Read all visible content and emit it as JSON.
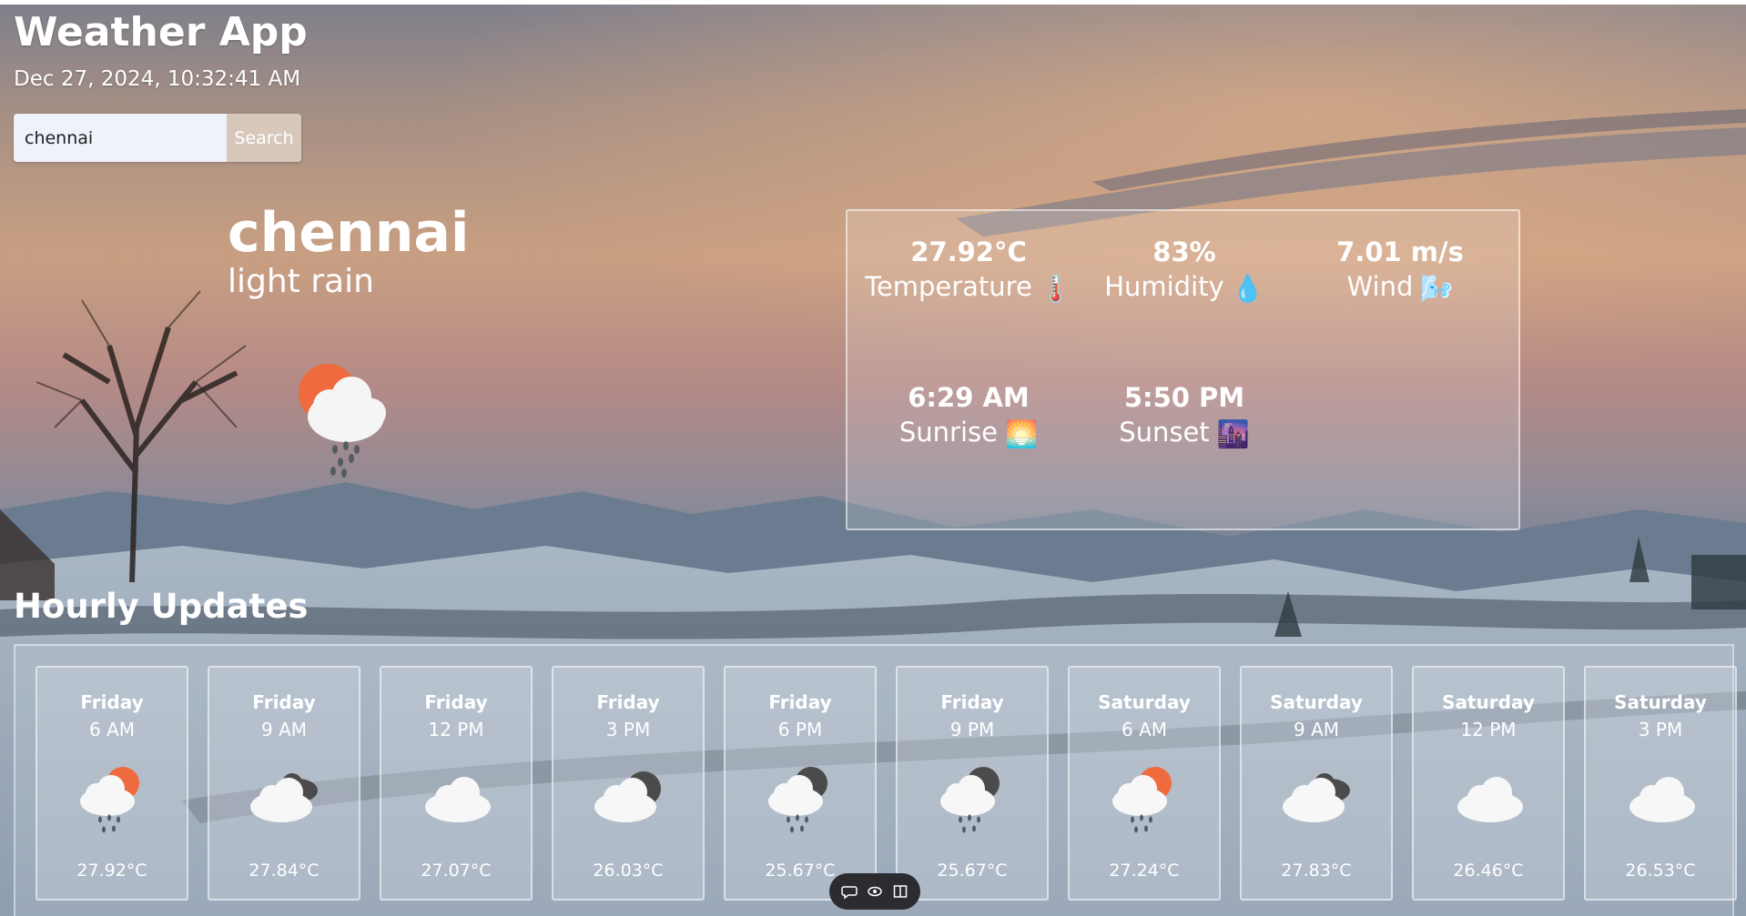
{
  "app": {
    "title": "Weather App",
    "datetime": "Dec 27, 2024, 10:32:41 AM"
  },
  "search": {
    "value": "chennai",
    "button_label": "Search"
  },
  "current": {
    "city": "chennai",
    "condition": "light rain",
    "icon": "sun-cloud-rain-icon"
  },
  "stats": [
    {
      "value": "27.92°C",
      "label": "Temperature",
      "emoji": "🌡️",
      "icon": "thermometer-icon"
    },
    {
      "value": "83%",
      "label": "Humidity",
      "emoji": "💧",
      "icon": "droplet-icon"
    },
    {
      "value": "7.01 m/s",
      "label": "Wind",
      "emoji": "🌬️",
      "icon": "wind-face-icon"
    },
    {
      "value": "6:29 AM",
      "label": "Sunrise",
      "emoji": "🌅",
      "icon": "sunrise-icon"
    },
    {
      "value": "5:50 PM",
      "label": "Sunset",
      "emoji": "🌆",
      "icon": "sunset-icon"
    }
  ],
  "hourly": {
    "title": "Hourly Updates",
    "items": [
      {
        "day": "Friday",
        "time": "6 AM",
        "temp": "27.92°C",
        "icon": "sun-cloud-rain-icon"
      },
      {
        "day": "Friday",
        "time": "9 AM",
        "temp": "27.84°C",
        "icon": "broken-clouds-icon"
      },
      {
        "day": "Friday",
        "time": "12 PM",
        "temp": "27.07°C",
        "icon": "cloud-icon"
      },
      {
        "day": "Friday",
        "time": "3 PM",
        "temp": "26.03°C",
        "icon": "night-cloud-icon"
      },
      {
        "day": "Friday",
        "time": "6 PM",
        "temp": "25.67°C",
        "icon": "night-cloud-rain-icon"
      },
      {
        "day": "Friday",
        "time": "9 PM",
        "temp": "25.67°C",
        "icon": "night-cloud-rain-icon"
      },
      {
        "day": "Saturday",
        "time": "6 AM",
        "temp": "27.24°C",
        "icon": "sun-cloud-rain-icon"
      },
      {
        "day": "Saturday",
        "time": "9 AM",
        "temp": "27.83°C",
        "icon": "broken-clouds-icon"
      },
      {
        "day": "Saturday",
        "time": "12 PM",
        "temp": "26.46°C",
        "icon": "cloud-icon"
      },
      {
        "day": "Saturday",
        "time": "3 PM",
        "temp": "26.53°C",
        "icon": "cloud-icon"
      }
    ]
  },
  "toolbar": {
    "items": [
      "comment-icon",
      "eye-icon",
      "panel-icon"
    ]
  },
  "colors": {
    "sun": "#ef6a3c",
    "cloud": "#f7f7f7",
    "dark_cloud": "#4b4b4b",
    "rain": "#555b63"
  }
}
